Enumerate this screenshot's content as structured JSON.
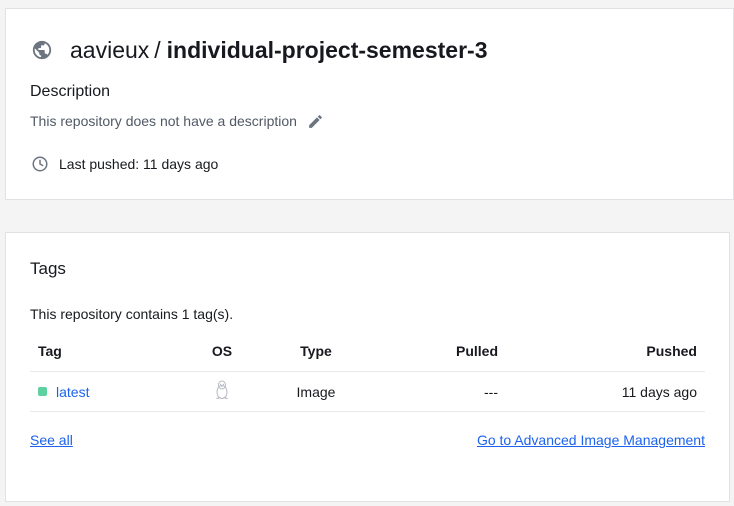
{
  "repo": {
    "namespace": "aavieux",
    "separator": "/",
    "name": "individual-project-semester-3",
    "visibility_icon": "globe-icon"
  },
  "description": {
    "heading": "Description",
    "text": "This repository does not have a description",
    "edit_icon": "pencil-icon"
  },
  "last_pushed": {
    "text": "Last pushed: 11 days ago",
    "icon": "clock-icon"
  },
  "tags": {
    "heading": "Tags",
    "count_text": "This repository contains 1 tag(s).",
    "columns": {
      "tag": "Tag",
      "os": "OS",
      "type": "Type",
      "pulled": "Pulled",
      "pushed": "Pushed"
    },
    "rows": [
      {
        "tag": "latest",
        "os_icon": "linux-tux-icon",
        "type": "Image",
        "pulled": "---",
        "pushed": "11 days ago",
        "status_color": "#5fd0a0"
      }
    ],
    "see_all": "See all",
    "advanced_link": "Go to Advanced Image Management"
  },
  "colors": {
    "link": "#1d63ed",
    "status_active": "#5fd0a0",
    "background": "#f4f4f5"
  }
}
